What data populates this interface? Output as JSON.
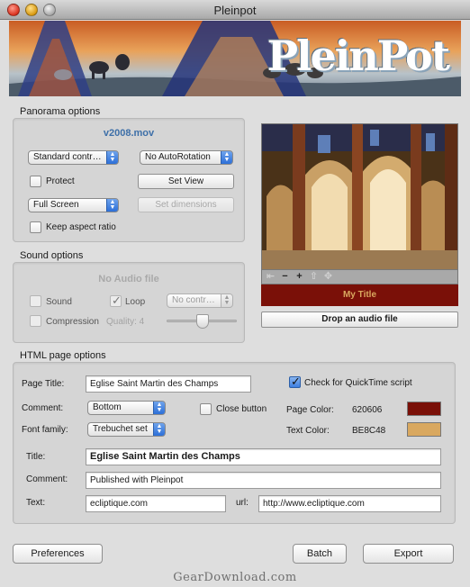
{
  "window": {
    "title": "Pleinpot"
  },
  "banner": {
    "logo_text": "PleinPot"
  },
  "panorama": {
    "group_title": "Panorama options",
    "file_name": "v2008.mov",
    "controller_popup": "Standard contr…",
    "autorotation_popup": "No AutoRotation",
    "protect_label": "Protect",
    "protect_checked": false,
    "set_view_label": "Set View",
    "size_popup": "Full Screen",
    "set_dimensions_label": "Set dimensions",
    "keep_aspect_label": "Keep aspect ratio",
    "keep_aspect_checked": false
  },
  "sound": {
    "group_title": "Sound options",
    "audio_file": "No Audio file",
    "sound_label": "Sound",
    "loop_label": "Loop",
    "loop_checked": true,
    "controller_popup": "No contr…",
    "compression_label": "Compression",
    "quality_label": "Quality: 4",
    "quality_value": 4
  },
  "preview": {
    "title": "My Title",
    "drop_audio_label": "Drop an audio file",
    "controls": [
      "⇤",
      "−",
      "+",
      "⇧",
      "✥"
    ]
  },
  "html": {
    "group_title": "HTML page options",
    "page_title_label": "Page Title:",
    "page_title_value": "Eglise Saint Martin des Champs",
    "quicktime_label": "Check for QuickTime script",
    "quicktime_checked": true,
    "comment_label": "Comment:",
    "comment_popup": "Bottom",
    "close_button_label": "Close button",
    "close_button_checked": false,
    "page_color_label": "Page Color:",
    "page_color_hex": "620606",
    "page_color": "#7a1008",
    "font_family_label": "Font family:",
    "font_family_popup": "Trebuchet set",
    "text_color_label": "Text Color:",
    "text_color_hex": "BE8C48",
    "text_color": "#d9a85f",
    "title_label": "Title:",
    "title_value": "Eglise Saint Martin des Champs",
    "comment2_label": "Comment:",
    "comment2_value": "Published with Pleinpot",
    "text_label": "Text:",
    "text_value": "ecliptique.com",
    "url_label": "url:",
    "url_value": "http://www.ecliptique.com"
  },
  "buttons": {
    "preferences": "Preferences",
    "batch": "Batch",
    "export": "Export"
  },
  "watermark": "GearDownload.com"
}
